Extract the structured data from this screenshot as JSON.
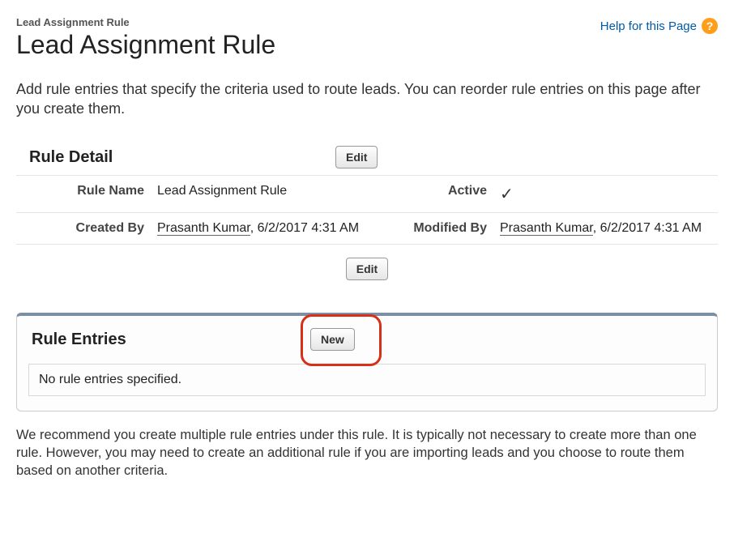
{
  "breadcrumb": "Lead Assignment Rule",
  "page_title": "Lead Assignment Rule",
  "help_link": "Help for this Page",
  "description": "Add rule entries that specify the criteria used to route leads. You can reorder rule entries on this page after you create them.",
  "rule_detail": {
    "section_title": "Rule Detail",
    "edit_label": "Edit",
    "fields": {
      "rule_name_label": "Rule Name",
      "rule_name_value": "Lead Assignment Rule",
      "active_label": "Active",
      "active_value": "✓",
      "created_by_label": "Created By",
      "created_by_user": "Prasanth Kumar",
      "created_by_time": ", 6/2/2017 4:31 AM",
      "modified_by_label": "Modified By",
      "modified_by_user": "Prasanth Kumar",
      "modified_by_time": ", 6/2/2017 4:31 AM"
    }
  },
  "rule_entries": {
    "section_title": "Rule Entries",
    "new_label": "New",
    "empty_message": "No rule entries specified."
  },
  "footer_note": "We recommend you create multiple rule entries under this rule. It is typically not necessary to create more than one rule. However, you may need to create an additional rule if you are importing leads and you choose to route them based on another criteria."
}
